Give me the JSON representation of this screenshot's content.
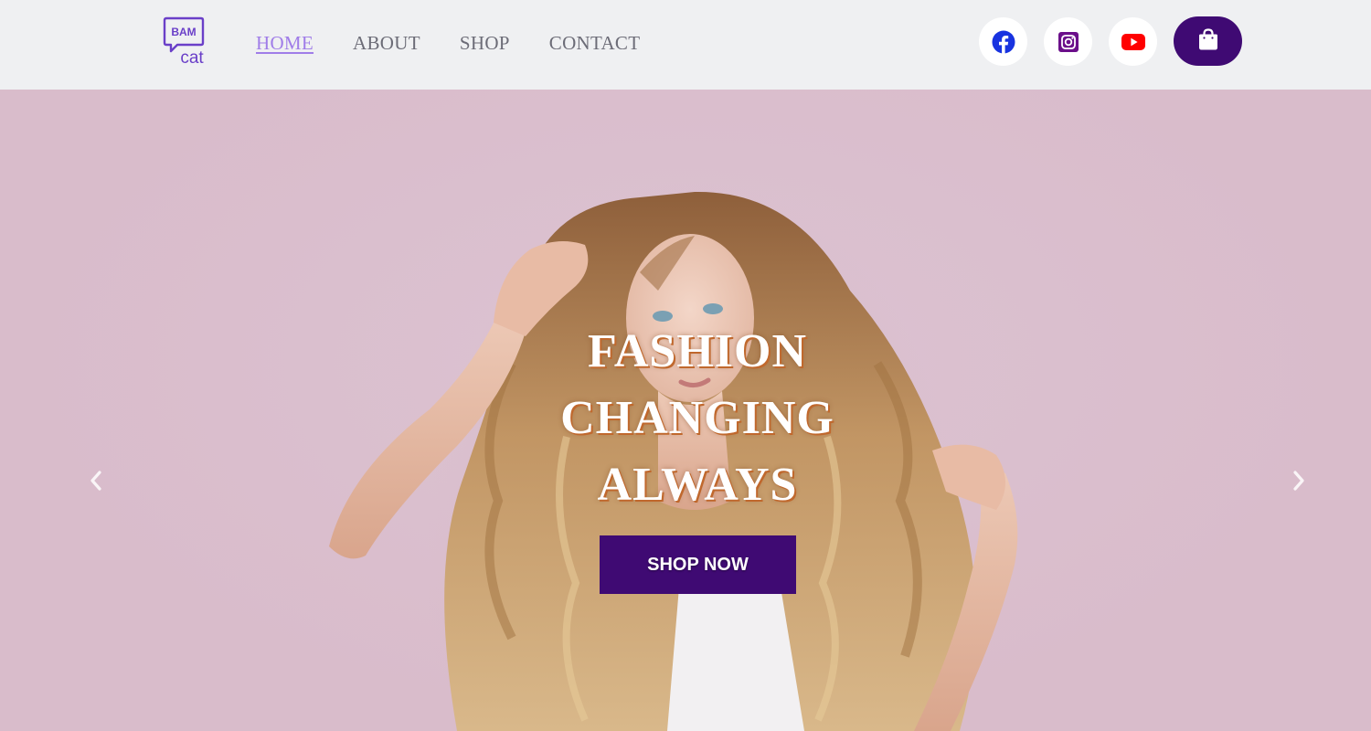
{
  "brand": {
    "logo_top": "BAM",
    "logo_bottom": "cat",
    "logo_color": "#6a3fc8"
  },
  "nav": {
    "links": [
      {
        "label": "HOME",
        "active": true
      },
      {
        "label": "ABOUT",
        "active": false
      },
      {
        "label": "SHOP",
        "active": false
      },
      {
        "label": "CONTACT",
        "active": false
      }
    ]
  },
  "social": [
    {
      "icon": "facebook-icon",
      "color": "#1833e0"
    },
    {
      "icon": "instagram-icon",
      "color": "#6b0f8a"
    },
    {
      "icon": "youtube-icon",
      "color": "#ff0000"
    }
  ],
  "cart": {
    "icon": "shopping-bag-icon",
    "color": "#3f0a73"
  },
  "hero": {
    "headline": [
      "FASHION",
      "CHANGING",
      "ALWAYS"
    ],
    "cta_label": "SHOP NOW",
    "cta_color": "#3f0a73",
    "prev_icon": "chevron-left-icon",
    "next_icon": "chevron-right-icon"
  }
}
